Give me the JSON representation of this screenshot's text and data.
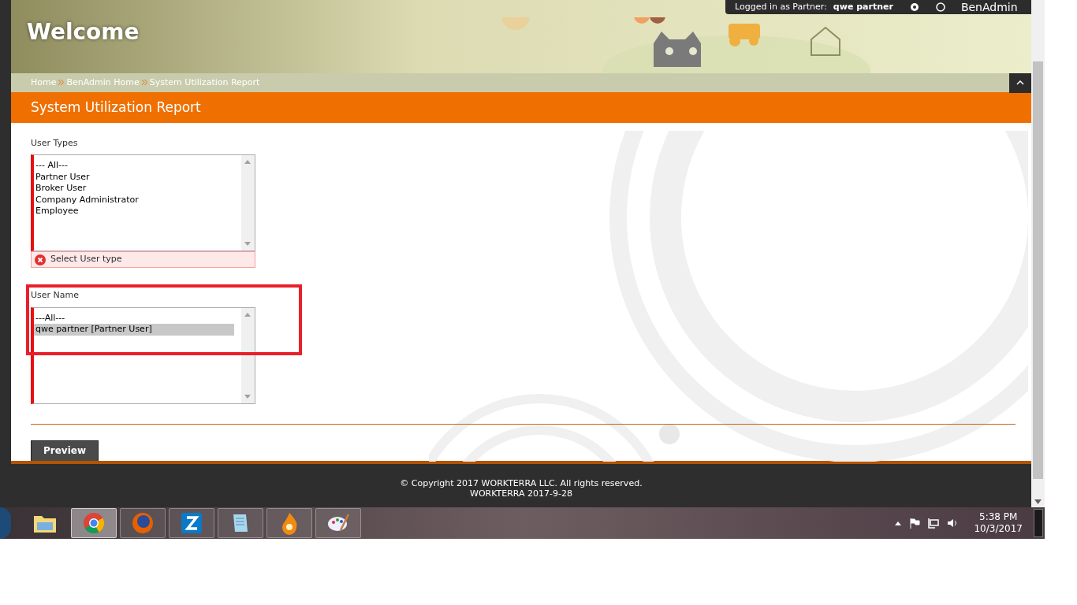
{
  "header": {
    "title": "Welcome",
    "user_bar": {
      "logged_in_label": "Logged in as Partner:",
      "user": "qwe partner",
      "account": "BenAdmin"
    }
  },
  "breadcrumb": [
    "Home",
    "BenAdmin Home",
    "System Utilization Report"
  ],
  "page_title": "System Utilization Report",
  "form": {
    "fields": [
      {
        "label": "User Types",
        "invalid": true,
        "options": [
          {
            "text": "--- All---",
            "selected": false
          },
          {
            "text": "Partner User",
            "selected": false
          },
          {
            "text": "Broker User",
            "selected": false
          },
          {
            "text": "Company Administrator",
            "selected": false
          },
          {
            "text": "Employee",
            "selected": false
          }
        ],
        "error": "Select User type"
      },
      {
        "label": "User Name",
        "invalid": true,
        "highlighted": true,
        "options": [
          {
            "text": "---All---",
            "selected": false
          },
          {
            "text": "qwe partner [Partner User]",
            "selected": true
          }
        ]
      }
    ],
    "button": "Preview"
  },
  "footer": [
    "© Copyright 2017 WORKTERRA LLC. All rights reserved.",
    "WORKTERRA 2017-9-28"
  ],
  "taskbar": {
    "apps": [
      {
        "kind": "folder",
        "active": false
      },
      {
        "kind": "chrome",
        "active": true
      },
      {
        "kind": "firefox",
        "active": false
      },
      {
        "kind": "z",
        "active": false
      },
      {
        "kind": "notepad",
        "active": false
      },
      {
        "kind": "flame",
        "active": false
      },
      {
        "kind": "paint",
        "active": false
      }
    ],
    "time": "5:38 PM",
    "date": "10/3/2017"
  }
}
